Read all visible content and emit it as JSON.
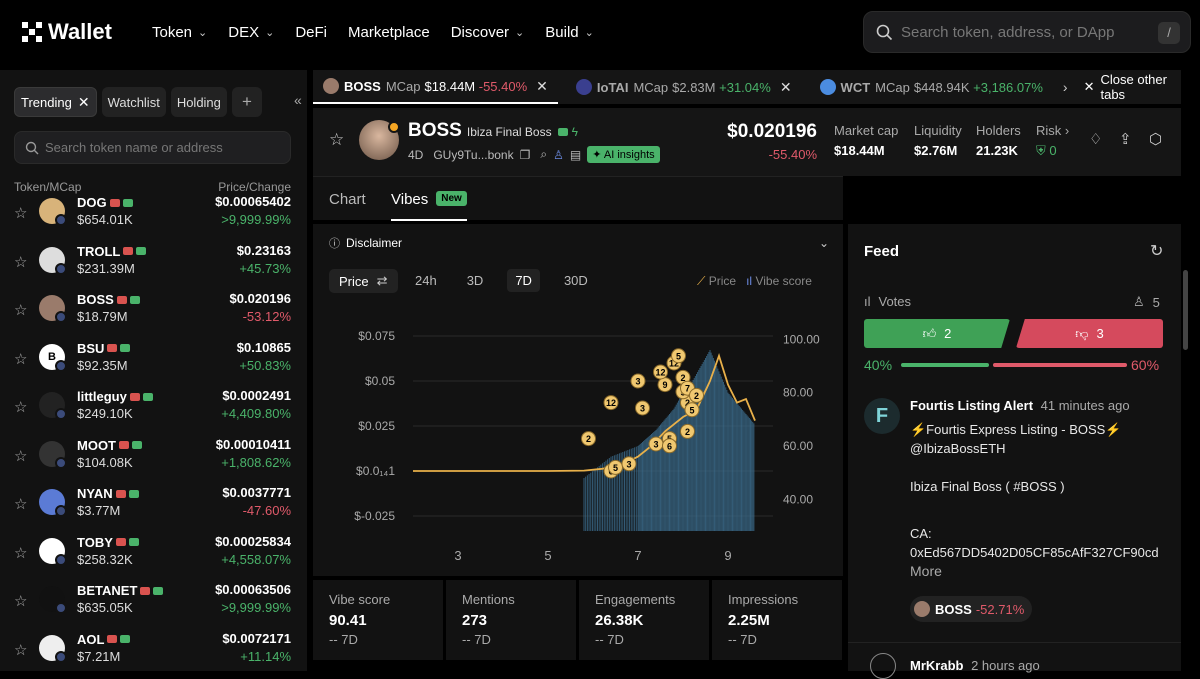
{
  "nav": {
    "brand": "Wallet",
    "items": [
      "Token",
      "DEX",
      "DeFi",
      "Marketplace",
      "Discover",
      "Build"
    ],
    "search_placeholder": "Search token, address, or DApp",
    "search_shortcut": "/"
  },
  "sidebar": {
    "filters": [
      "Trending",
      "Watchlist",
      "Holding"
    ],
    "search_placeholder": "Search token name or address",
    "col_left": "Token/MCap",
    "col_right": "Price/Change",
    "tokens": [
      {
        "name": "DOG",
        "mcap": "$654.01K",
        "price": "$0.00065402",
        "change": ">9,999.99%",
        "dir": "up",
        "color": "#d8b37a"
      },
      {
        "name": "TROLL",
        "mcap": "$231.39M",
        "price": "$0.23163",
        "change": "+45.73%",
        "dir": "up",
        "color": "#ddd"
      },
      {
        "name": "BOSS",
        "mcap": "$18.79M",
        "price": "$0.020196",
        "change": "-53.12%",
        "dir": "dn",
        "color": "#9a7b6b"
      },
      {
        "name": "BSU",
        "mcap": "$92.35M",
        "price": "$0.10865",
        "change": "+50.83%",
        "dir": "up",
        "color": "#fff",
        "letter": "B"
      },
      {
        "name": "littleguy",
        "mcap": "$249.10K",
        "price": "$0.0002491",
        "change": "+4,409.80%",
        "dir": "up",
        "color": "#222"
      },
      {
        "name": "MOOT",
        "mcap": "$104.08K",
        "price": "$0.00010411",
        "change": "+1,808.62%",
        "dir": "up",
        "color": "#333"
      },
      {
        "name": "NYAN",
        "mcap": "$3.77M",
        "price": "$0.0037771",
        "change": "-47.60%",
        "dir": "dn",
        "color": "#5b7bd5"
      },
      {
        "name": "TOBY",
        "mcap": "$258.32K",
        "price": "$0.00025834",
        "change": "+4,558.07%",
        "dir": "up",
        "color": "#fff"
      },
      {
        "name": "BETANET",
        "mcap": "$635.05K",
        "price": "$0.00063506",
        "change": ">9,999.99%",
        "dir": "up",
        "color": "#111"
      },
      {
        "name": "AOL",
        "mcap": "$7.21M",
        "price": "$0.0072171",
        "change": "+11.14%",
        "dir": "up",
        "color": "#eee"
      }
    ]
  },
  "tabs": [
    {
      "name": "BOSS",
      "mcap_label": "MCap",
      "mcap": "$18.44M",
      "change": "-55.40%",
      "dir": "dn"
    },
    {
      "name": "IoTAI",
      "mcap_label": "MCap",
      "mcap": "$2.83M",
      "change": "+31.04%",
      "dir": "up"
    },
    {
      "name": "WCT",
      "mcap_label": "MCap",
      "mcap": "$448.94K",
      "change": "+3,186.07%",
      "dir": "up"
    }
  ],
  "close_tabs": "Close other tabs",
  "token": {
    "symbol": "BOSS",
    "full_name": "Ibiza Final Boss",
    "age": "4D",
    "address": "GUy9Tu...bonk",
    "ai_label": "AI insights",
    "price": "$0.020196",
    "change": "-55.40%",
    "stats": [
      {
        "label": "Market cap",
        "value": "$18.44M"
      },
      {
        "label": "Liquidity",
        "value": "$2.76M"
      },
      {
        "label": "Holders",
        "value": "21.23K"
      },
      {
        "label": "Risk",
        "value": "0"
      }
    ]
  },
  "view_tabs": {
    "chart": "Chart",
    "vibes": "Vibes",
    "new_badge": "New"
  },
  "disclaimer": "Disclaimer",
  "chart_controls": {
    "metric": "Price",
    "ranges": [
      "24h",
      "3D",
      "7D",
      "30D"
    ],
    "active_range": "7D",
    "legend_price": "Price",
    "legend_vibe": "Vibe score"
  },
  "chart_data": {
    "type": "line",
    "y_left_ticks": [
      "$0.075",
      "$0.05",
      "$0.025",
      "$0.0₁₄1",
      "$-0.025"
    ],
    "y_right_ticks": [
      "100.00",
      "80.00",
      "60.00",
      "40.00"
    ],
    "x_ticks": [
      "3",
      "5",
      "7",
      "9"
    ],
    "xlim": [
      2,
      10
    ],
    "ylim_left": [
      -0.025,
      0.075
    ],
    "ylim_right": [
      30,
      105
    ],
    "series": [
      {
        "name": "Price",
        "x": [
          2.0,
          4.0,
          5.0,
          5.8,
          6.2,
          6.6,
          7.0,
          7.3,
          7.6,
          8.0,
          8.3,
          8.6,
          8.8,
          9.0,
          9.2,
          9.4,
          9.6
        ],
        "values": [
          0.0,
          0.0,
          0.0,
          0.0002,
          0.0012,
          0.003,
          0.008,
          0.014,
          0.022,
          0.03,
          0.034,
          0.05,
          0.064,
          0.048,
          0.038,
          0.04,
          0.028
        ]
      },
      {
        "name": "Vibe score",
        "x": [
          5.8,
          6.1,
          6.4,
          6.7,
          7.0,
          7.2,
          7.4,
          7.6,
          7.8,
          8.0,
          8.2,
          8.4,
          8.6,
          8.8,
          9.0,
          9.2,
          9.4,
          9.6
        ],
        "values": [
          48,
          52,
          56,
          58,
          60,
          63,
          66,
          70,
          74,
          80,
          84,
          90,
          96,
          88,
          80,
          76,
          72,
          68
        ]
      }
    ],
    "markers": [
      {
        "x": 6.4,
        "y": 0.0,
        "label": "6"
      },
      {
        "x": 5.9,
        "y": 0.018,
        "label": "2"
      },
      {
        "x": 6.5,
        "y": 0.002,
        "label": "5"
      },
      {
        "x": 6.8,
        "y": 0.004,
        "label": "3"
      },
      {
        "x": 7.4,
        "y": 0.015,
        "label": "3"
      },
      {
        "x": 7.7,
        "y": 0.018,
        "label": "5"
      },
      {
        "x": 7.7,
        "y": 0.014,
        "label": "6"
      },
      {
        "x": 8.1,
        "y": 0.022,
        "label": "2"
      },
      {
        "x": 8.1,
        "y": 0.038,
        "label": "2"
      },
      {
        "x": 8.0,
        "y": 0.044,
        "label": "5"
      },
      {
        "x": 7.6,
        "y": 0.048,
        "label": "9"
      },
      {
        "x": 7.5,
        "y": 0.055,
        "label": "12"
      },
      {
        "x": 7.8,
        "y": 0.06,
        "label": "12"
      },
      {
        "x": 7.9,
        "y": 0.064,
        "label": "5"
      },
      {
        "x": 8.0,
        "y": 0.052,
        "label": "2"
      },
      {
        "x": 8.1,
        "y": 0.046,
        "label": "7"
      },
      {
        "x": 8.3,
        "y": 0.042,
        "label": "2"
      },
      {
        "x": 8.2,
        "y": 0.034,
        "label": "5"
      },
      {
        "x": 7.1,
        "y": 0.035,
        "label": "3"
      },
      {
        "x": 6.4,
        "y": 0.038,
        "label": "12"
      },
      {
        "x": 7.0,
        "y": 0.05,
        "label": "3"
      }
    ]
  },
  "stats": [
    {
      "label": "Vibe score",
      "value": "90.41",
      "sub": "-- 7D"
    },
    {
      "label": "Mentions",
      "value": "273",
      "sub": "-- 7D"
    },
    {
      "label": "Engagements",
      "value": "26.38K",
      "sub": "-- 7D"
    },
    {
      "label": "Impressions",
      "value": "2.25M",
      "sub": "-- 7D"
    }
  ],
  "feed": {
    "title": "Feed",
    "votes_label": "Votes",
    "voters": "5",
    "up_votes": "2",
    "down_votes": "3",
    "up_pct": "40%",
    "down_pct": "60%",
    "up_fraction": 0.4,
    "post": {
      "author": "Fourtis Listing Alert",
      "time": "41 minutes ago",
      "line1": "⚡Fourtis Express Listing - BOSS⚡",
      "line2": "@IbizaBossETH",
      "line3": "Ibiza Final Boss ( #BOSS )",
      "line4": "CA:",
      "line5": "0xEd567DD5402D05CF85cAfF327CF90cd",
      "more": "More",
      "token": "BOSS",
      "token_change": "-52.71%"
    },
    "post2": {
      "author": "MrKrabb",
      "time": "2 hours ago"
    }
  },
  "colors": {
    "green": "#4ab36a",
    "red": "#e05a6a",
    "vote_up": "#3fa156",
    "vote_down": "#d54a5d"
  }
}
